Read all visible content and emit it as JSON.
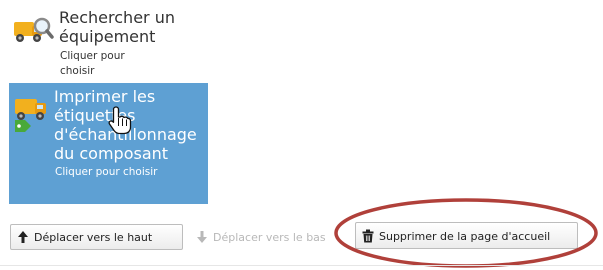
{
  "tiles": [
    {
      "title": "Rechercher un équipement",
      "subtitle": "Cliquer pour choisir",
      "icon": "truck-search-icon"
    },
    {
      "title": "Imprimer les étiquettes d'échantillonnage du composant",
      "subtitle": "Cliquer pour choisir",
      "icon": "truck-label-icon",
      "selected": true,
      "selected_color": "#5ea0d3"
    }
  ],
  "toolbar": {
    "move_up_label": "Déplacer vers le haut",
    "move_down_label": "Déplacer vers le bas",
    "remove_label": "Supprimer de la page d'accueil",
    "move_up_icon": "arrow-up-icon",
    "move_down_icon": "arrow-down-icon",
    "remove_icon": "trash-icon"
  },
  "colors": {
    "annotation_ellipse": "#b0403a",
    "disabled_text": "#b8b8b8"
  }
}
